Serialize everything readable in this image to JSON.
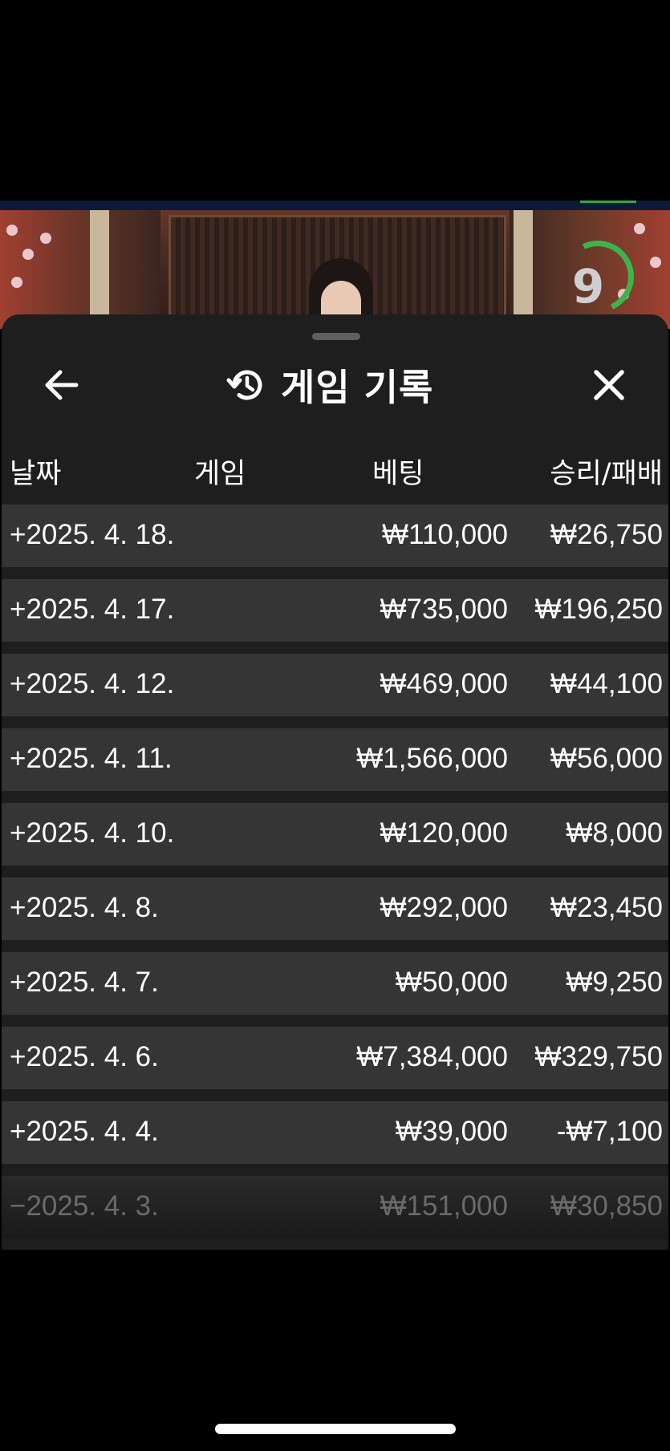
{
  "timer": {
    "value": "9"
  },
  "header": {
    "title": "게임 기록",
    "back_icon": "arrow-left-icon",
    "history_icon": "history-icon",
    "close_icon": "close-icon"
  },
  "columns": {
    "date": "날짜",
    "game": "게임",
    "bet": "베팅",
    "win_loss": "승리/패배"
  },
  "rows": [
    {
      "date": "+2025. 4. 18.",
      "bet": "₩110,000",
      "win": "₩26,750"
    },
    {
      "date": "+2025. 4. 17.",
      "bet": "₩735,000",
      "win": "₩196,250"
    },
    {
      "date": "+2025. 4. 12.",
      "bet": "₩469,000",
      "win": "₩44,100"
    },
    {
      "date": "+2025. 4. 11.",
      "bet": "₩1,566,000",
      "win": "₩56,000"
    },
    {
      "date": "+2025. 4. 10.",
      "bet": "₩120,000",
      "win": "₩8,000"
    },
    {
      "date": "+2025. 4. 8.",
      "bet": "₩292,000",
      "win": "₩23,450"
    },
    {
      "date": "+2025. 4. 7.",
      "bet": "₩50,000",
      "win": "₩9,250"
    },
    {
      "date": "+2025. 4. 6.",
      "bet": "₩7,384,000",
      "win": "₩329,750"
    },
    {
      "date": "+2025. 4. 4.",
      "bet": "₩39,000",
      "win": "-₩7,100"
    },
    {
      "date": "−2025. 4. 3.",
      "bet": "₩151,000",
      "win": "₩30,850"
    }
  ],
  "colors": {
    "sheet_bg": "#1e1e1e",
    "row_bg": "#353535",
    "timer_ring": "#3bb54a"
  }
}
